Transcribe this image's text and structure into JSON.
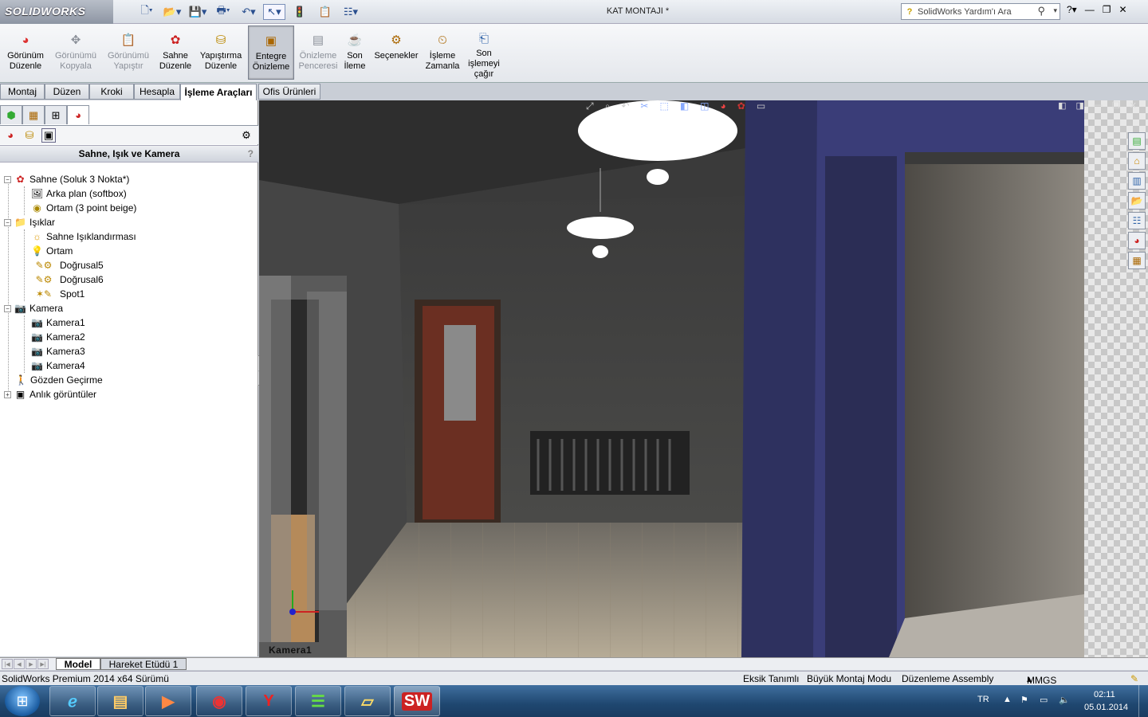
{
  "app": {
    "logo": "SOLIDWORKS",
    "window_title": "KAT MONTAJI *"
  },
  "search": {
    "placeholder": "SolidWorks Yardım'ı Ara"
  },
  "ribbon": {
    "buttons": [
      {
        "line1": "Görünüm",
        "line2": "Düzenle",
        "line3": "",
        "disabled": false
      },
      {
        "line1": "Görünümü",
        "line2": "Kopyala",
        "line3": "",
        "disabled": true
      },
      {
        "line1": "Görünümü",
        "line2": "Yapıştır",
        "line3": "",
        "disabled": true
      },
      {
        "line1": "Sahne",
        "line2": "Düzenle",
        "line3": "",
        "disabled": false
      },
      {
        "line1": "Yapıştırma",
        "line2": "Düzenle",
        "line3": "",
        "disabled": false
      },
      {
        "line1": "Entegre",
        "line2": "Önizleme",
        "line3": "",
        "disabled": false,
        "active": true
      },
      {
        "line1": "Önizleme",
        "line2": "Penceresi",
        "line3": "",
        "disabled": true
      },
      {
        "line1": "Son",
        "line2": "İleme",
        "line3": "",
        "disabled": false
      },
      {
        "line1": "Seçenekler",
        "line2": "",
        "line3": "",
        "disabled": false
      },
      {
        "line1": "İşleme",
        "line2": "Zamanla",
        "line3": "",
        "disabled": false
      },
      {
        "line1": "Son",
        "line2": "işlemeyi",
        "line3": "çağır",
        "disabled": false
      }
    ]
  },
  "tabs": [
    "Montaj",
    "Düzen",
    "Kroki",
    "Hesapla",
    "İşleme Araçları",
    "Ofis Ürünleri"
  ],
  "panel": {
    "header": "Sahne, Işık ve Kamera",
    "help": "?",
    "tree": [
      {
        "label": "Sahne (Soluk 3 Nokta*)",
        "icon": "scene-icon"
      },
      {
        "label": "Arka plan (softbox)",
        "icon": "background-icon"
      },
      {
        "label": "Ortam (3 point beige)",
        "icon": "environment-icon"
      },
      {
        "label": "Işıklar",
        "icon": "lights-folder-icon"
      },
      {
        "label": "Sahne Işıklandırması",
        "icon": "scene-lighting-icon"
      },
      {
        "label": "Ortam",
        "icon": "ambient-bulb-icon"
      },
      {
        "label": "Doğrusal5",
        "icon": "directional-light-icon"
      },
      {
        "label": "Doğrusal6",
        "icon": "directional-light-icon"
      },
      {
        "label": "Spot1",
        "icon": "spotlight-icon"
      },
      {
        "label": "Kamera",
        "icon": "camera-folder-icon"
      },
      {
        "label": "Kamera1",
        "icon": "camera-icon"
      },
      {
        "label": "Kamera2",
        "icon": "camera-icon"
      },
      {
        "label": "Kamera3",
        "icon": "camera-icon"
      },
      {
        "label": "Kamera4",
        "icon": "camera-icon"
      },
      {
        "label": "Gözden Geçirme",
        "icon": "walkthrough-icon"
      },
      {
        "label": "Anlık görüntüler",
        "icon": "snapshots-icon"
      }
    ]
  },
  "viewport": {
    "camera_label": "Kamera1"
  },
  "bottom_tabs": [
    "Model",
    "Hareket Etüdü 1"
  ],
  "status": {
    "version": "SolidWorks Premium 2014 x64 Sürümü",
    "definition": "Eksik Tanımlı",
    "mode": "Büyük Montaj Modu",
    "editing": "Düzenleme Assembly",
    "units": "MMGS"
  },
  "taskbar": {
    "lang": "TR",
    "time": "02:11",
    "date": "05.01.2014"
  },
  "colors": {
    "accent": "#2a4f8f",
    "wall_blue": "#3a3d78",
    "taskbar": "#1f4770"
  }
}
